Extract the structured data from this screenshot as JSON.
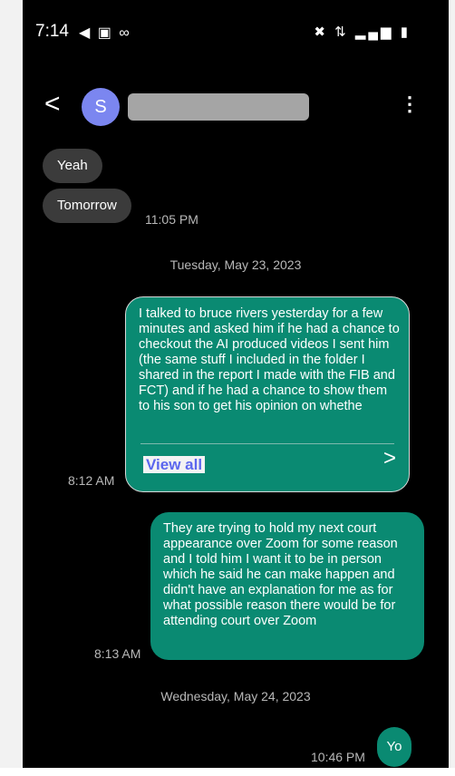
{
  "status_bar": {
    "time": "7:14",
    "left_icons": "◀ ▣ ∞",
    "right_icons": "✖ ⇅ ▂▄▆ ▮"
  },
  "header": {
    "back_glyph": "<",
    "avatar_initial": "S",
    "menu_glyph": "⋮"
  },
  "messages": {
    "incoming": [
      {
        "text": "Yeah"
      },
      {
        "text": "Tomorrow",
        "time": "11:05 PM"
      }
    ],
    "date_1": "Tuesday, May 23, 2023",
    "out_1": {
      "text": "I talked to bruce rivers yesterday for a few minutes and asked him if he had a chance to checkout the AI produced videos I sent him (the same stuff I included in the folder I shared in the report I made with the FIB and FCT) and if he had a chance to show them to his son to get his opinion on whethe",
      "action": "View all",
      "chevron": ">",
      "time": "8:12 AM"
    },
    "out_2": {
      "text": "They are trying to hold my next court appearance over Zoom for some reason and I told him I want it to be in person which he said he can make happen and didn't have an explanation for me as for what possible reason there would be for attending court over Zoom",
      "time": "8:13 AM"
    },
    "date_2": "Wednesday, May 24, 2023",
    "out_3": {
      "text": "Yo",
      "time": "10:46 PM"
    }
  },
  "colors": {
    "background": "#000000",
    "incoming_bubble": "#3b3b3b",
    "outgoing_bubble": "#0a8a72",
    "avatar": "#7b86f0",
    "link": "#5c67ee"
  }
}
